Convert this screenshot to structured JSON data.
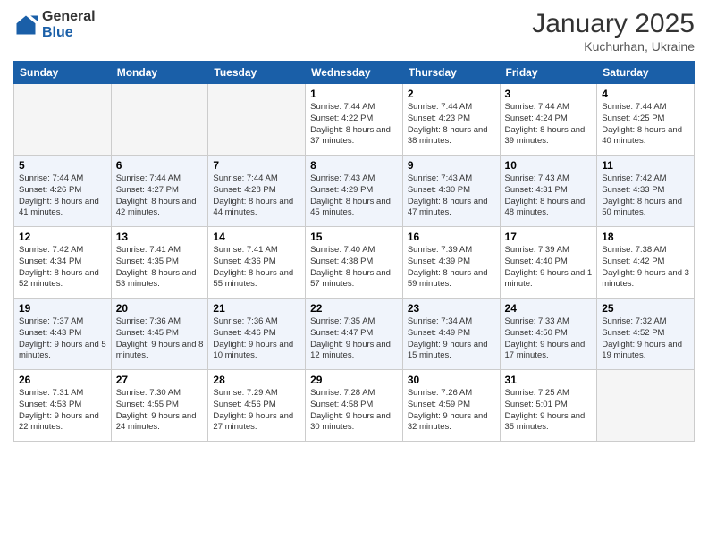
{
  "header": {
    "logo": {
      "general": "General",
      "blue": "Blue"
    },
    "title": "January 2025",
    "location": "Kuchurhan, Ukraine"
  },
  "weekdays": [
    "Sunday",
    "Monday",
    "Tuesday",
    "Wednesday",
    "Thursday",
    "Friday",
    "Saturday"
  ],
  "weeks": [
    [
      {
        "day": "",
        "info": ""
      },
      {
        "day": "",
        "info": ""
      },
      {
        "day": "",
        "info": ""
      },
      {
        "day": "1",
        "info": "Sunrise: 7:44 AM\nSunset: 4:22 PM\nDaylight: 8 hours and 37 minutes."
      },
      {
        "day": "2",
        "info": "Sunrise: 7:44 AM\nSunset: 4:23 PM\nDaylight: 8 hours and 38 minutes."
      },
      {
        "day": "3",
        "info": "Sunrise: 7:44 AM\nSunset: 4:24 PM\nDaylight: 8 hours and 39 minutes."
      },
      {
        "day": "4",
        "info": "Sunrise: 7:44 AM\nSunset: 4:25 PM\nDaylight: 8 hours and 40 minutes."
      }
    ],
    [
      {
        "day": "5",
        "info": "Sunrise: 7:44 AM\nSunset: 4:26 PM\nDaylight: 8 hours and 41 minutes."
      },
      {
        "day": "6",
        "info": "Sunrise: 7:44 AM\nSunset: 4:27 PM\nDaylight: 8 hours and 42 minutes."
      },
      {
        "day": "7",
        "info": "Sunrise: 7:44 AM\nSunset: 4:28 PM\nDaylight: 8 hours and 44 minutes."
      },
      {
        "day": "8",
        "info": "Sunrise: 7:43 AM\nSunset: 4:29 PM\nDaylight: 8 hours and 45 minutes."
      },
      {
        "day": "9",
        "info": "Sunrise: 7:43 AM\nSunset: 4:30 PM\nDaylight: 8 hours and 47 minutes."
      },
      {
        "day": "10",
        "info": "Sunrise: 7:43 AM\nSunset: 4:31 PM\nDaylight: 8 hours and 48 minutes."
      },
      {
        "day": "11",
        "info": "Sunrise: 7:42 AM\nSunset: 4:33 PM\nDaylight: 8 hours and 50 minutes."
      }
    ],
    [
      {
        "day": "12",
        "info": "Sunrise: 7:42 AM\nSunset: 4:34 PM\nDaylight: 8 hours and 52 minutes."
      },
      {
        "day": "13",
        "info": "Sunrise: 7:41 AM\nSunset: 4:35 PM\nDaylight: 8 hours and 53 minutes."
      },
      {
        "day": "14",
        "info": "Sunrise: 7:41 AM\nSunset: 4:36 PM\nDaylight: 8 hours and 55 minutes."
      },
      {
        "day": "15",
        "info": "Sunrise: 7:40 AM\nSunset: 4:38 PM\nDaylight: 8 hours and 57 minutes."
      },
      {
        "day": "16",
        "info": "Sunrise: 7:39 AM\nSunset: 4:39 PM\nDaylight: 8 hours and 59 minutes."
      },
      {
        "day": "17",
        "info": "Sunrise: 7:39 AM\nSunset: 4:40 PM\nDaylight: 9 hours and 1 minute."
      },
      {
        "day": "18",
        "info": "Sunrise: 7:38 AM\nSunset: 4:42 PM\nDaylight: 9 hours and 3 minutes."
      }
    ],
    [
      {
        "day": "19",
        "info": "Sunrise: 7:37 AM\nSunset: 4:43 PM\nDaylight: 9 hours and 5 minutes."
      },
      {
        "day": "20",
        "info": "Sunrise: 7:36 AM\nSunset: 4:45 PM\nDaylight: 9 hours and 8 minutes."
      },
      {
        "day": "21",
        "info": "Sunrise: 7:36 AM\nSunset: 4:46 PM\nDaylight: 9 hours and 10 minutes."
      },
      {
        "day": "22",
        "info": "Sunrise: 7:35 AM\nSunset: 4:47 PM\nDaylight: 9 hours and 12 minutes."
      },
      {
        "day": "23",
        "info": "Sunrise: 7:34 AM\nSunset: 4:49 PM\nDaylight: 9 hours and 15 minutes."
      },
      {
        "day": "24",
        "info": "Sunrise: 7:33 AM\nSunset: 4:50 PM\nDaylight: 9 hours and 17 minutes."
      },
      {
        "day": "25",
        "info": "Sunrise: 7:32 AM\nSunset: 4:52 PM\nDaylight: 9 hours and 19 minutes."
      }
    ],
    [
      {
        "day": "26",
        "info": "Sunrise: 7:31 AM\nSunset: 4:53 PM\nDaylight: 9 hours and 22 minutes."
      },
      {
        "day": "27",
        "info": "Sunrise: 7:30 AM\nSunset: 4:55 PM\nDaylight: 9 hours and 24 minutes."
      },
      {
        "day": "28",
        "info": "Sunrise: 7:29 AM\nSunset: 4:56 PM\nDaylight: 9 hours and 27 minutes."
      },
      {
        "day": "29",
        "info": "Sunrise: 7:28 AM\nSunset: 4:58 PM\nDaylight: 9 hours and 30 minutes."
      },
      {
        "day": "30",
        "info": "Sunrise: 7:26 AM\nSunset: 4:59 PM\nDaylight: 9 hours and 32 minutes."
      },
      {
        "day": "31",
        "info": "Sunrise: 7:25 AM\nSunset: 5:01 PM\nDaylight: 9 hours and 35 minutes."
      },
      {
        "day": "",
        "info": ""
      }
    ]
  ]
}
